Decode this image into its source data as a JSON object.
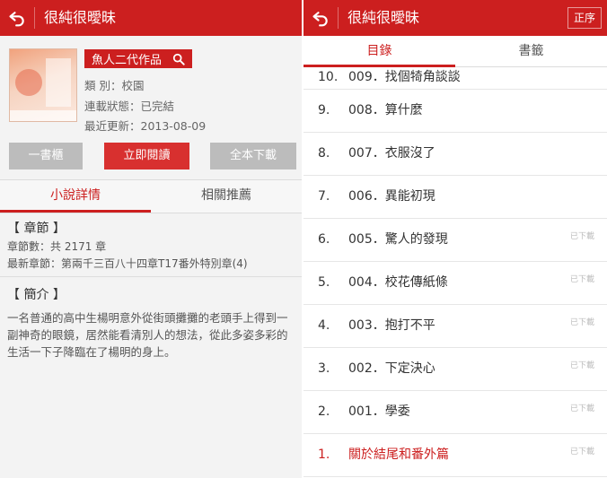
{
  "left": {
    "title": "很純很曖昧",
    "author_button": "魚人二代作品",
    "meta": {
      "category": "類 別：校園",
      "status": "連載狀態：已完結",
      "updated": "最近更新：2013-08-09"
    },
    "buttons": {
      "bookshelf": "一書櫃",
      "read": "立即閱讀",
      "download": "全本下載"
    },
    "tabs": [
      "小說詳情",
      "相關推薦"
    ],
    "chapters_section": {
      "heading": "【 章節 】",
      "count": "章節數：共 2171 章",
      "latest": "最新章節：第兩千三百八十四章T17番外特別章(4)"
    },
    "synopsis_section": {
      "heading": "【 簡介 】",
      "text": "一名普通的高中生楊明意外從街頭攤攤的老頭手上得到一副神奇的眼鏡，居然能看清別人的想法，從此多姿多彩的生活一下子降臨在了楊明的身上。"
    }
  },
  "right": {
    "title": "很純很曖昧",
    "order_button": "正序",
    "tabs": [
      "目錄",
      "書籤"
    ],
    "chapters": [
      {
        "num": "10.",
        "name": "009．找個犄角談談",
        "downloaded": ""
      },
      {
        "num": "9.",
        "name": "008．算什麼",
        "downloaded": ""
      },
      {
        "num": "8.",
        "name": "007．衣服沒了",
        "downloaded": ""
      },
      {
        "num": "7.",
        "name": "006．異能初現",
        "downloaded": ""
      },
      {
        "num": "6.",
        "name": "005．驚人的發現",
        "downloaded": "已下載"
      },
      {
        "num": "5.",
        "name": "004．校花傳紙條",
        "downloaded": "已下載"
      },
      {
        "num": "4.",
        "name": "003．抱打不平",
        "downloaded": "已下載"
      },
      {
        "num": "3.",
        "name": "002．下定決心",
        "downloaded": "已下載"
      },
      {
        "num": "2.",
        "name": "001．學委",
        "downloaded": "已下載"
      },
      {
        "num": "1.",
        "name": "關於結尾和番外篇",
        "downloaded": "已下載"
      }
    ]
  },
  "colors": {
    "accent": "#cc1f1f",
    "button_gray": "#bcbcbc",
    "muted_text": "#bbbbbb"
  }
}
